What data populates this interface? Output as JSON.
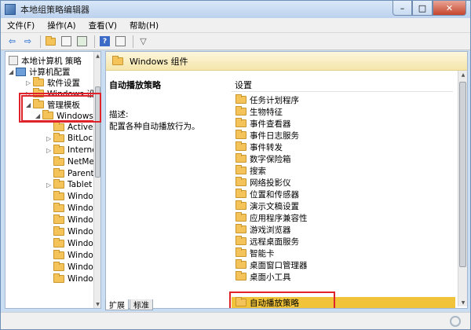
{
  "window": {
    "title": "本地组策略编辑器",
    "controls": {
      "minimize": "–",
      "maximize": "□",
      "close": "✕"
    }
  },
  "menubar": [
    "文件(F)",
    "操作(A)",
    "查看(V)",
    "帮助(H)"
  ],
  "toolbar": {
    "icons": [
      "back-arrow-icon",
      "forward-arrow-icon",
      "up-folder-icon",
      "show-hide-tree-icon",
      "export-list-icon",
      "help-icon",
      "properties-icon",
      "filter-icon"
    ],
    "help_glyph": "?"
  },
  "tree": {
    "root": "本地计算机 策略",
    "computer_config": "计算机配置",
    "software_settings": "软件设置",
    "windows_settings": "Windows 设置",
    "admin_templates": "管理模板",
    "windows_components": "Windows 组",
    "children": [
      "ActiveX",
      "BitLock",
      "Interne",
      "NetMe",
      "Parent",
      "Tablet",
      "Windo",
      "Windo",
      "Windo",
      "Windo",
      "Windo",
      "Windo",
      "Windo",
      "Windo"
    ]
  },
  "right_pane": {
    "header_title": "Windows 组件",
    "policy_title": "自动播放策略",
    "description_label": "描述:",
    "description_text": "配置各种自动播放行为。",
    "column_header": "设置",
    "items": [
      "任务计划程序",
      "生物特征",
      "事件查看器",
      "事件日志服务",
      "事件转发",
      "数字保险箱",
      "搜索",
      "网络投影仪",
      "位置和传感器",
      "演示文稿设置",
      "应用程序兼容性",
      "游戏浏览器",
      "远程桌面服务",
      "智能卡",
      "桌面窗口管理器",
      "桌面小工具",
      "自动播放策略"
    ],
    "selected_item": "自动播放策略"
  },
  "tabs": [
    "扩展",
    "标准"
  ],
  "colors": {
    "highlight_red": "#e0232b",
    "selection_gold": "#f0c33a",
    "folder_yellow": "#f4c45a"
  }
}
